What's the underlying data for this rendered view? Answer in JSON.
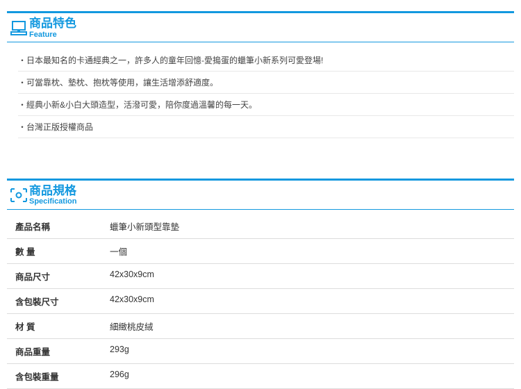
{
  "feature": {
    "title_zh": "商品特色",
    "title_en": "Feature",
    "items": [
      "・日本最知名的卡通經典之一，許多人的童年回憶-愛搗蛋的蠟筆小新系列可愛登場!",
      "・可當靠枕、墊枕、抱枕等使用，讓生活增添舒適度。",
      "・經典小新&小白大頭造型，活潑可愛，陪你度過溫馨的每一天。",
      "・台灣正版授權商品"
    ]
  },
  "spec": {
    "title_zh": "商品規格",
    "title_en": "Specification",
    "rows": [
      {
        "label": "產品名稱",
        "value": "蠟筆小新頭型靠墊"
      },
      {
        "label": "數 量",
        "value": "一個"
      },
      {
        "label": "商品尺寸",
        "value": "42x30x9cm"
      },
      {
        "label": "含包裝尺寸",
        "value": "42x30x9cm"
      },
      {
        "label": "材 質",
        "value": "細緻桃皮絨"
      },
      {
        "label": "商品重量",
        "value": "293g"
      },
      {
        "label": "含包裝重量",
        "value": "296g"
      }
    ]
  }
}
